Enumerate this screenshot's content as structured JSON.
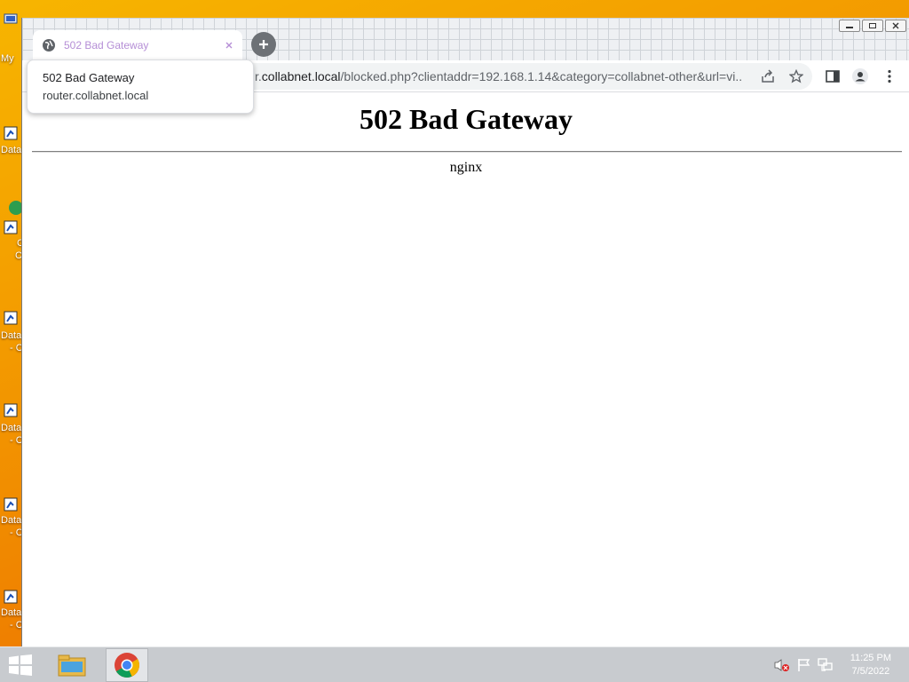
{
  "desktop": {
    "icons": [
      {
        "label": "My",
        "glyph": "computer-icon"
      },
      {
        "label": "Data",
        "glyph": "shortcut-icon"
      },
      {
        "label": "C",
        "glyph": "chrome-shortcut-icon"
      },
      {
        "label": "C",
        "glyph": "chrome-shortcut-icon"
      },
      {
        "label": "Data",
        "glyph": "shortcut-icon"
      },
      {
        "label": "- C",
        "glyph": "shortcut-icon"
      },
      {
        "label": "Data",
        "glyph": "shortcut-icon"
      },
      {
        "label": "- C",
        "glyph": "shortcut-icon"
      },
      {
        "label": "Data",
        "glyph": "shortcut-icon"
      },
      {
        "label": "- C",
        "glyph": "shortcut-icon"
      },
      {
        "label": "Data",
        "glyph": "shortcut-icon"
      },
      {
        "label": "- C",
        "glyph": "shortcut-icon"
      }
    ]
  },
  "browser": {
    "tab": {
      "title": "502 Bad Gateway",
      "favicon": "globe-icon"
    },
    "url": {
      "prefix": "r.",
      "host": "collabnet.local",
      "path": "/blocked.php?clientaddr=192.168.1.14&category=collabnet-other&url=vi..."
    },
    "hover_card": {
      "title": "502 Bad Gateway",
      "domain": "router.collabnet.local"
    }
  },
  "page": {
    "heading": "502 Bad Gateway",
    "server": "nginx"
  },
  "taskbar": {
    "clock_time": "11:25 PM",
    "clock_date": "7/5/2022"
  },
  "colors": {
    "desktop_bg": "#f39a00",
    "tab_title": "#b58ed6",
    "taskbar_bg": "#c8cbcf"
  }
}
